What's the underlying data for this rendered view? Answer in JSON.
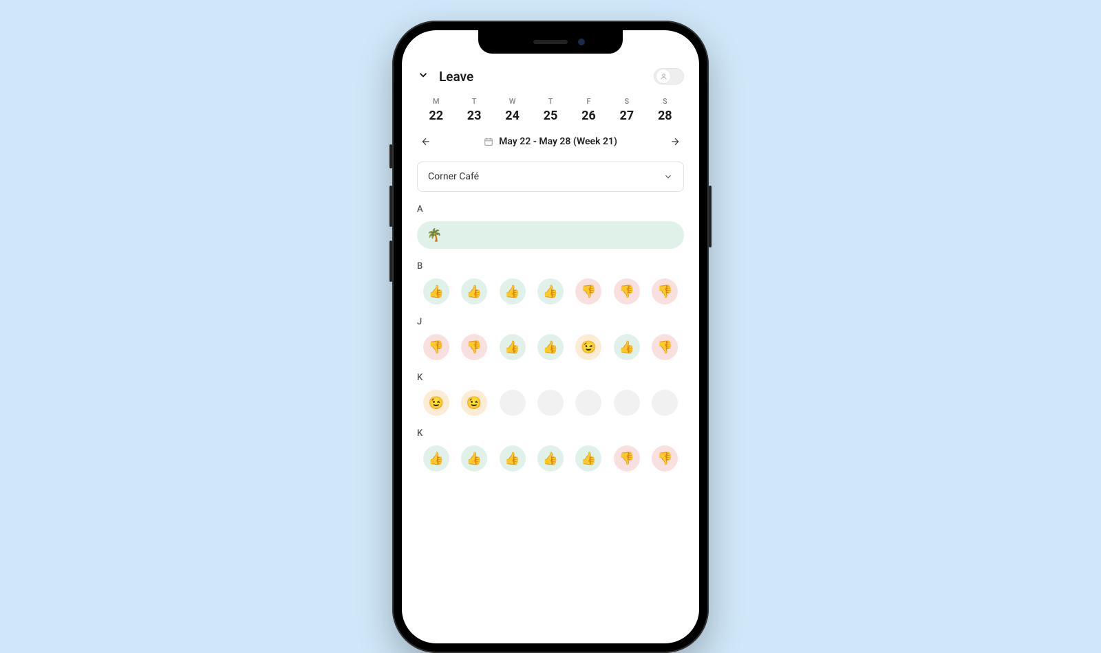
{
  "header": {
    "title": "Leave"
  },
  "week": {
    "days": [
      {
        "label": "M",
        "num": "22"
      },
      {
        "label": "T",
        "num": "23"
      },
      {
        "label": "W",
        "num": "24"
      },
      {
        "label": "T",
        "num": "25"
      },
      {
        "label": "F",
        "num": "26"
      },
      {
        "label": "S",
        "num": "27"
      },
      {
        "label": "S",
        "num": "28"
      }
    ],
    "range_label": "May 22 - May 28 (Week 21)"
  },
  "location": {
    "selected": "Corner Café"
  },
  "status_emoji": {
    "up": "👍",
    "down": "👎",
    "maybe": "😉",
    "palm": "🌴"
  },
  "employees": [
    {
      "initial": "A",
      "leave_full_week": true
    },
    {
      "initial": "B",
      "statuses": [
        "up",
        "up",
        "up",
        "up",
        "down",
        "down",
        "down"
      ]
    },
    {
      "initial": "J",
      "statuses": [
        "down",
        "down",
        "up",
        "up",
        "maybe",
        "up",
        "down"
      ]
    },
    {
      "initial": "K",
      "statuses": [
        "maybe",
        "maybe",
        "empty",
        "empty",
        "empty",
        "empty",
        "empty"
      ]
    },
    {
      "initial": "K",
      "statuses": [
        "up",
        "up",
        "up",
        "up",
        "up",
        "down",
        "down"
      ]
    }
  ]
}
